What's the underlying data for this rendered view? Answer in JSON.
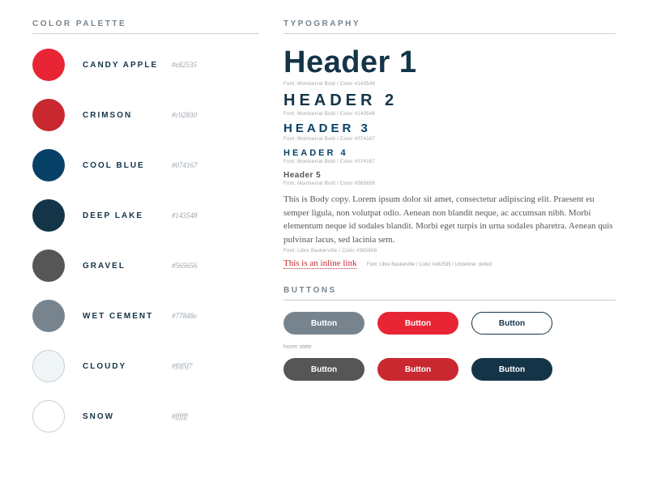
{
  "palette": {
    "title": "COLOR PALETTE",
    "items": [
      {
        "name": "CANDY APPLE",
        "hex": "#e82535"
      },
      {
        "name": "CRIMSON",
        "hex": "#c92830"
      },
      {
        "name": "COOL BLUE",
        "hex": "#074167"
      },
      {
        "name": "DEEP LAKE",
        "hex": "#143548"
      },
      {
        "name": "GRAVEL",
        "hex": "#565656"
      },
      {
        "name": "WET CEMENT",
        "hex": "#77848e"
      },
      {
        "name": "CLOUDY",
        "hex": "#f0f5f7"
      },
      {
        "name": "SNOW",
        "hex": "#ffffff"
      }
    ]
  },
  "typography": {
    "title": "TYPOGRAPHY",
    "h1": {
      "text": "Header 1",
      "meta": "Font: Montserrat Bold / Color #143548"
    },
    "h2": {
      "text": "HEADER 2",
      "meta": "Font: Montserrat Bold / Color #143548"
    },
    "h3": {
      "text": "HEADER 3",
      "meta": "Font: Montserrat Bold / Color #074167"
    },
    "h4": {
      "text": "HEADER 4",
      "meta": "Font: Montserrat Bold / Color #074167"
    },
    "h5": {
      "text": "Header 5",
      "meta": "Font: Montserrat Bold / Color #565656"
    },
    "body": {
      "text": "This is Body copy. Lorem ipsum dolor sit amet, consectetur adipiscing elit. Praesent eu semper ligula, non volutpat odio. Aenean non blandit neque, ac accumsan nibh. Morbi elementum neque id sodales blandit. Morbi eget turpis in urna sodales pharetra. Aenean quis pulvinar lacus, sed lacinia sem.",
      "meta": "Font: Libre Baskerville / Color #565656"
    },
    "link": {
      "text": "This is an inline link",
      "meta": "Font: Libre Baskerville / Color #e82535 / Underline: dotted"
    }
  },
  "buttons": {
    "title": "BUTTONS",
    "label": "Button",
    "hover_label": "hover state"
  }
}
